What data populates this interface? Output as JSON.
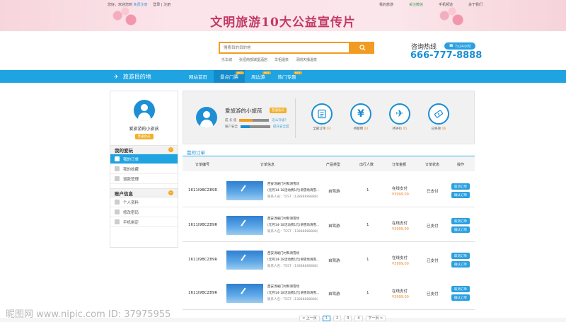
{
  "colors": {
    "accent": "#1fa3e1",
    "orange": "#f29b22",
    "brand_pink": "#c23a64",
    "badge": "#f1b02a"
  },
  "topbar": {
    "welcome": "您好，欢迎您到",
    "register": "免费注册",
    "login_sep": "登录 | 注册",
    "links": [
      "我的旅游",
      "关注微信",
      "手机频道",
      "关于我们"
    ],
    "banner_title": "文明旅游10大公益宣传片"
  },
  "search": {
    "placeholder": "搜索目的目的地",
    "hot_links": [
      "乐华城",
      "张垣南部城堡酒店",
      "华祖温泉",
      "汤岗天播温泉"
    ]
  },
  "hotline": {
    "label": "咨询热线",
    "badge": "7x24小时",
    "number": "666-777-8888"
  },
  "nav": {
    "destination_label": "旅游目的地",
    "items": [
      {
        "label": "网站首页",
        "tag": ""
      },
      {
        "label": "景点门票",
        "tag": "HOT"
      },
      {
        "label": "周边游",
        "tag": "HOT"
      },
      {
        "label": "热门专题",
        "tag": "HOT"
      }
    ]
  },
  "sidebar": {
    "username": "爱旅游的小旅孩",
    "badge": "普通会员",
    "section1": "我的爱玩",
    "section1_items": [
      "我的订单",
      "我的收藏",
      "退款管理"
    ],
    "section2": "账户信息",
    "section2_items": [
      "个人资料",
      "修改密码",
      "手机绑定"
    ]
  },
  "profile": {
    "name": "爱旅游的小旅孩",
    "badge": "普通会员",
    "row1_label": "成 长 值",
    "row1_link": "怎么升级？",
    "row1_progress": 0.45,
    "row2_label": "账户安全",
    "row2_link": "提升安全度",
    "row2_progress": 0.3,
    "stats": [
      {
        "label": "全部订单",
        "count": "03"
      },
      {
        "label": "待使用",
        "count": "02"
      },
      {
        "label": "待评价",
        "count": "05"
      },
      {
        "label": "已失效",
        "count": "06"
      }
    ]
  },
  "orders": {
    "title": "我的订单",
    "headers": [
      "订单编号",
      "订单信息",
      "产品类型",
      "出行人数",
      "订单金额",
      "订单状态",
      "操作"
    ],
    "rows": [
      {
        "no": "1611I9BCZ89R",
        "t1": "西安汤峪门村和滑雪场",
        "t2": "(元月14-18活动费1元)滑雪场滑雪...",
        "t3": "联系人名：TEST（13888888888）",
        "type": "自驾游",
        "people": "1",
        "pay": "在线支付",
        "amount": "¥3999.00",
        "status": "已支付",
        "cancel": "取消订单",
        "confirm": "确认订单"
      },
      {
        "no": "1611I9BCZ89R",
        "t1": "西安汤峪门村和滑雪场",
        "t2": "(元月14-18活动费1元)滑雪场滑雪...",
        "t3": "联系人名：TEST（13888888888）",
        "type": "自驾游",
        "people": "1",
        "pay": "在线支付",
        "amount": "¥3999.00",
        "status": "已支付",
        "cancel": "取消订单",
        "confirm": "确认订单"
      },
      {
        "no": "1611I9BCZ89R",
        "t1": "西安汤峪门村和滑雪场",
        "t2": "(元月14-18活动费1元)滑雪场滑雪...",
        "t3": "联系人名：TEST（13888888888）",
        "type": "自驾游",
        "people": "1",
        "pay": "在线支付",
        "amount": "¥3999.00",
        "status": "已支付",
        "cancel": "取消订单",
        "confirm": "确认订单"
      },
      {
        "no": "1611I9BCZ89R",
        "t1": "西安汤峪门村和滑雪场",
        "t2": "(元月14-18活动费1元)滑雪场滑雪...",
        "t3": "联系人名：TEST（13888888888）",
        "type": "自驾游",
        "people": "1",
        "pay": "在线支付",
        "amount": "¥3999.00",
        "status": "已支付",
        "cancel": "取消订单",
        "confirm": "确认订单"
      }
    ]
  },
  "pager": {
    "prev": "< 上一页",
    "pages": [
      "1",
      "2",
      "3",
      "4"
    ],
    "next": "下一页 >"
  },
  "watermark": "昵图网 www.nipic.com  ID: 37975955"
}
